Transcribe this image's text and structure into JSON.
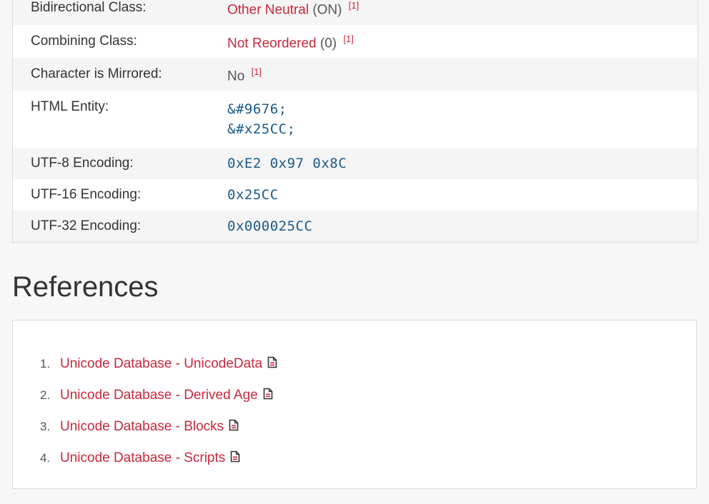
{
  "properties": [
    {
      "label": "Bidirectional Class:",
      "link": "Other Neutral",
      "extra": "(ON)",
      "ref": "[1]"
    },
    {
      "label": "Combining Class:",
      "link": "Not Reordered",
      "extra": "(0)",
      "ref": "[1]"
    },
    {
      "label": "Character is Mirrored:",
      "text": "No",
      "ref": "[1]"
    },
    {
      "label": "HTML Entity:",
      "codes": [
        "&#9676;",
        "&#x25CC;"
      ]
    },
    {
      "label": "UTF-8 Encoding:",
      "code": "0xE2 0x97 0x8C"
    },
    {
      "label": "UTF-16 Encoding:",
      "code": "0x25CC"
    },
    {
      "label": "UTF-32 Encoding:",
      "code": "0x000025CC"
    }
  ],
  "references": {
    "title": "References",
    "items": [
      {
        "num": "1.",
        "label": "Unicode Database - UnicodeData",
        "icon": "document-icon"
      },
      {
        "num": "2.",
        "label": "Unicode Database - Derived Age",
        "icon": "document-icon"
      },
      {
        "num": "3.",
        "label": "Unicode Database - Blocks",
        "icon": "document-icon"
      },
      {
        "num": "4.",
        "label": "Unicode Database - Scripts",
        "icon": "document-icon"
      }
    ]
  },
  "colors": {
    "link": "#c8283c",
    "code": "#1a5a8a",
    "stripe": "#f5f5f5"
  }
}
